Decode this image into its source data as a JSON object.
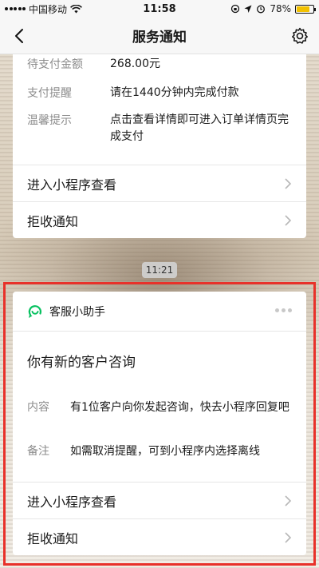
{
  "status_bar": {
    "carrier": "中国移动",
    "time": "11:58",
    "battery": "78%",
    "battery_level": 0.78
  },
  "nav": {
    "title": "服务通知",
    "back_icon": "chevron-left-icon",
    "settings_icon": "gear-icon"
  },
  "card1": {
    "fields": [
      {
        "label": "待支付金额",
        "value": "268.00元"
      },
      {
        "label": "支付提醒",
        "value": "请在1440分钟内完成付款"
      },
      {
        "label": "温馨提示",
        "value": "点击查看详情即可进入订单详情页完成支付"
      }
    ],
    "actions": [
      {
        "label": "进入小程序查看"
      },
      {
        "label": "拒收通知"
      }
    ]
  },
  "timestamp": "11:21",
  "card2": {
    "sender": "客服小助手",
    "title": "你有新的客户咨询",
    "fields": [
      {
        "label": "内容",
        "value": "有1位客户向你发起咨询，快去小程序回复吧"
      },
      {
        "label": "备注",
        "value": "如需取消提醒，可到小程序内选择离线"
      }
    ],
    "actions": [
      {
        "label": "进入小程序查看"
      },
      {
        "label": "拒收通知"
      }
    ]
  },
  "colors": {
    "highlight": "#e8312a",
    "brand_green": "#07c160",
    "battery": "#f2c100"
  }
}
